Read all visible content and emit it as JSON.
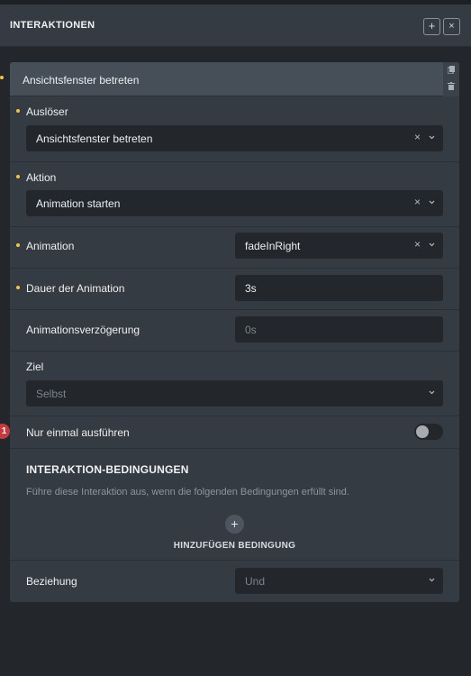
{
  "header": {
    "title": "INTERAKTIONEN",
    "add_label": "+",
    "close_label": "×"
  },
  "card": {
    "title": "Ansichtsfenster betreten",
    "copy_icon": "copy-icon",
    "delete_icon": "trash-icon"
  },
  "fields": {
    "trigger": {
      "label": "Auslöser",
      "value": "Ansichtsfenster betreten",
      "clear": "×"
    },
    "action": {
      "label": "Aktion",
      "value": "Animation starten",
      "clear": "×"
    },
    "animation": {
      "label": "Animation",
      "value": "fadeInRight",
      "clear": "×"
    },
    "duration": {
      "label": "Dauer der Animation",
      "value": "3s"
    },
    "delay": {
      "label": "Animationsverzögerung",
      "placeholder": "0s"
    },
    "target": {
      "label": "Ziel",
      "placeholder": "Selbst"
    },
    "run_once": {
      "label": "Nur einmal ausführen",
      "badge": "1",
      "enabled": false
    }
  },
  "conditions": {
    "title": "INTERAKTION-BEDINGUNGEN",
    "description": "Führe diese Interaktion aus, wenn die folgenden Bedingungen erfüllt sind.",
    "add_icon": "+",
    "add_label": "HINZUFÜGEN BEDINGUNG"
  },
  "relation": {
    "label": "Beziehung",
    "placeholder": "Und"
  },
  "colors": {
    "background": "#23272c",
    "panel": "#353b42",
    "card_header": "#464e57",
    "required_dot": "#f5c542",
    "badge": "#c9383c"
  }
}
